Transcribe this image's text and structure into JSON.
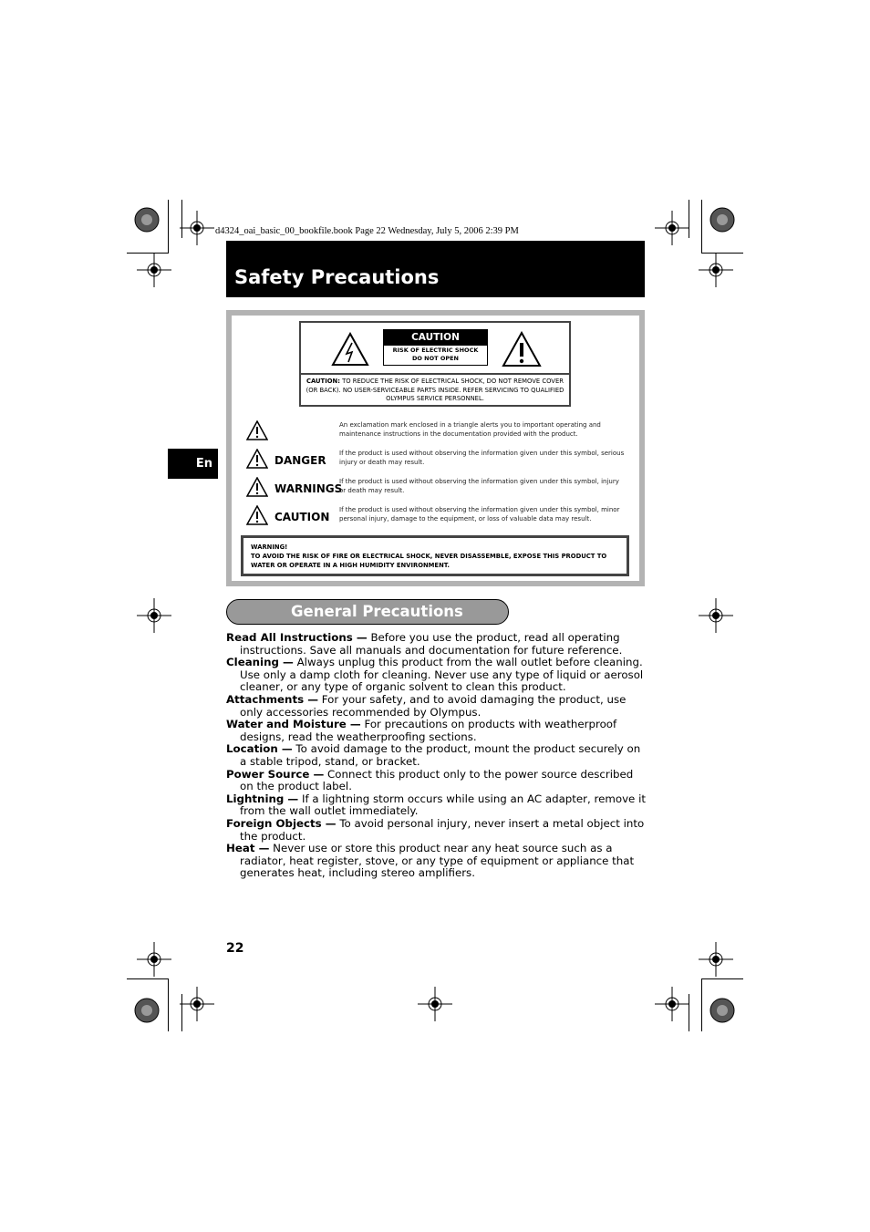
{
  "header_line": "d4324_oai_basic_00_bookfile.book  Page 22  Wednesday, July 5, 2006  2:39 PM",
  "title": "Safety Precautions",
  "language_tab": "En",
  "caution_label": {
    "heading": "CAUTION",
    "sub_line1": "RISK OF ELECTRIC SHOCK",
    "sub_line2": "DO NOT OPEN",
    "text_bold": "CAUTION:",
    "text": "TO REDUCE THE RISK OF ELECTRICAL SHOCK, DO NOT REMOVE COVER (OR BACK). NO USER-SERVICEABLE PARTS INSIDE. REFER SERVICING TO QUALIFIED OLYMPUS SERVICE PERSONNEL."
  },
  "symbols": [
    {
      "word": "",
      "desc": "An exclamation mark enclosed in a triangle alerts you to important operating and maintenance instructions in the documentation provided with the product."
    },
    {
      "word": "DANGER",
      "desc": "If the product is used without observing the information given under this symbol, serious injury or death may result."
    },
    {
      "word": "WARNINGS",
      "desc": "If the product is used without observing the information given under this symbol, injury or death may result."
    },
    {
      "word": "CAUTION",
      "desc": "If the product is used without observing the information given under this symbol, minor personal injury, damage to the equipment, or loss of valuable data may result."
    }
  ],
  "warning_box": {
    "heading": "WARNING!",
    "text": "TO AVOID THE RISK OF FIRE OR ELECTRICAL SHOCK, NEVER DISASSEMBLE, EXPOSE THIS PRODUCT TO WATER OR OPERATE IN A HIGH HUMIDITY ENVIRONMENT."
  },
  "general": {
    "heading": "General Precautions",
    "items": [
      {
        "term": "Read All Instructions —",
        "text": " Before you use the product, read all operating instructions. Save all manuals and documentation for future reference."
      },
      {
        "term": "Cleaning —",
        "text": " Always unplug this product from the wall outlet before cleaning. Use only a damp cloth for cleaning. Never use any type of liquid or aerosol cleaner, or any type of organic solvent to clean this product."
      },
      {
        "term": "Attachments —",
        "text": " For your safety, and to avoid damaging the product, use only accessories recommended by Olympus."
      },
      {
        "term": "Water and Moisture —",
        "text": " For precautions on products with weatherproof designs, read the weatherproofing sections."
      },
      {
        "term": "Location —",
        "text": " To avoid damage to the product, mount the product securely on a stable tripod, stand, or bracket."
      },
      {
        "term": "Power Source —",
        "text": " Connect this product only to the power source described on the product label."
      },
      {
        "term": "Lightning —",
        "text": " If a lightning storm occurs while using an AC adapter, remove it from the wall outlet immediately."
      },
      {
        "term": "Foreign Objects —",
        "text": " To avoid personal injury, never insert a metal object into the product."
      },
      {
        "term": "Heat —",
        "text": " Never use or store this product near any heat source such as a radiator, heat register, stove, or any type of equipment or appliance that generates heat, including stereo amplifiers."
      }
    ]
  },
  "page_number": "22"
}
